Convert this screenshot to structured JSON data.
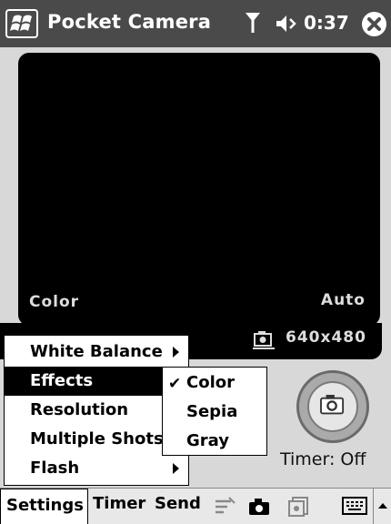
{
  "titlebar": {
    "app_title": "Pocket Camera",
    "clock": "0:37",
    "icons": [
      "start-flag-icon",
      "signal-icon",
      "volume-icon",
      "close-icon"
    ]
  },
  "viewfinder": {
    "effect": "Color",
    "white_balance": "Auto",
    "resolution": "640x480"
  },
  "menu": {
    "items": [
      {
        "label": "White Balance",
        "has_submenu": true
      },
      {
        "label": "Effects",
        "has_submenu": false,
        "highlighted": true
      },
      {
        "label": "Resolution",
        "has_submenu": false
      },
      {
        "label": "Multiple Shots",
        "has_submenu": false
      },
      {
        "label": "Flash",
        "has_submenu": true
      }
    ],
    "effects_submenu": [
      {
        "label": "Color",
        "checked": true
      },
      {
        "label": "Sepia",
        "checked": false
      },
      {
        "label": "Gray",
        "checked": false
      }
    ]
  },
  "timer_label": "Timer: Off",
  "bottombar": {
    "settings": "Settings",
    "timer": "Timer",
    "send": "Send"
  }
}
